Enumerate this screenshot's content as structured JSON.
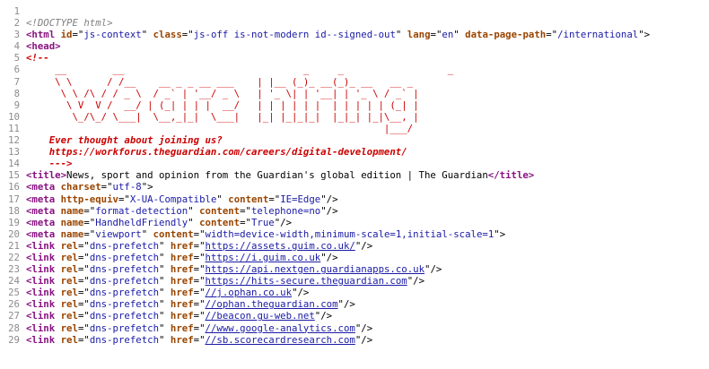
{
  "viewer": {
    "name": "page-source-view"
  },
  "lines": [
    {
      "n": "1",
      "parts": []
    },
    {
      "n": "2",
      "parts": [
        {
          "c": "doct",
          "t": "<!DOCTYPE html>"
        }
      ]
    },
    {
      "n": "3",
      "parts": [
        {
          "c": "tag",
          "t": "<html"
        },
        {
          "c": "punc",
          "t": " "
        },
        {
          "c": "anm",
          "t": "id"
        },
        {
          "c": "punc",
          "t": "=\""
        },
        {
          "c": "av",
          "t": "js-context"
        },
        {
          "c": "punc",
          "t": "\" "
        },
        {
          "c": "anm",
          "t": "class"
        },
        {
          "c": "punc",
          "t": "=\""
        },
        {
          "c": "av",
          "t": "js-off is-not-modern id--signed-out"
        },
        {
          "c": "punc",
          "t": "\" "
        },
        {
          "c": "anm",
          "t": "lang"
        },
        {
          "c": "punc",
          "t": "=\""
        },
        {
          "c": "av",
          "t": "en"
        },
        {
          "c": "punc",
          "t": "\" "
        },
        {
          "c": "anm",
          "t": "data-page-path"
        },
        {
          "c": "punc",
          "t": "=\""
        },
        {
          "c": "av",
          "t": "/international"
        },
        {
          "c": "punc",
          "t": "\">"
        }
      ]
    },
    {
      "n": "4",
      "parts": [
        {
          "c": "tag",
          "t": "<head>"
        }
      ]
    },
    {
      "n": "5",
      "parts": [
        {
          "c": "cmtb",
          "t": "<!--"
        }
      ]
    },
    {
      "n": "6",
      "parts": [
        {
          "c": "cmtart",
          "t": "     __        __                               _     _                  _               "
        }
      ]
    },
    {
      "n": "7",
      "parts": [
        {
          "c": "cmtart",
          "t": "     \\ \\      / /__    __ _ _ __ ___    | |__ (_)_ __(_)_ __   __ _ "
        }
      ]
    },
    {
      "n": "8",
      "parts": [
        {
          "c": "cmtart",
          "t": "      \\ \\ /\\ / / _ \\  / _` | '__/ _ \\   | '_ \\| | '__| | '_ \\ / _` |"
        }
      ]
    },
    {
      "n": "9",
      "parts": [
        {
          "c": "cmtart",
          "t": "       \\ V  V /  __/ | (_| | | |  __/   | | | | | |  | | | | | (_| |"
        }
      ]
    },
    {
      "n": "10",
      "parts": [
        {
          "c": "cmtart",
          "t": "        \\_/\\_/ \\___|  \\__,_|_|  \\___|   |_| |_|_|_|  |_|_| |_|\\__, |"
        }
      ]
    },
    {
      "n": "11",
      "parts": [
        {
          "c": "cmtart",
          "t": "                                                              |___/ "
        }
      ]
    },
    {
      "n": "12",
      "parts": [
        {
          "c": "cmtb",
          "t": "    Ever thought about joining us?"
        }
      ]
    },
    {
      "n": "13",
      "parts": [
        {
          "c": "cmtb",
          "t": "    https://workforus.theguardian.com/careers/digital-development/"
        }
      ]
    },
    {
      "n": "14",
      "parts": [
        {
          "c": "cmtb",
          "t": "    --->"
        }
      ]
    },
    {
      "n": "15",
      "parts": [
        {
          "c": "tag",
          "t": "<title>"
        },
        {
          "c": "txt",
          "t": "News, sport and opinion from the Guardian's global edition | The Guardian"
        },
        {
          "c": "tag",
          "t": "</title>"
        }
      ]
    },
    {
      "n": "16",
      "parts": [
        {
          "c": "tag",
          "t": "<meta"
        },
        {
          "c": "punc",
          "t": " "
        },
        {
          "c": "anm",
          "t": "charset"
        },
        {
          "c": "punc",
          "t": "=\""
        },
        {
          "c": "av",
          "t": "utf-8"
        },
        {
          "c": "punc",
          "t": "\">"
        }
      ]
    },
    {
      "n": "17",
      "parts": [
        {
          "c": "tag",
          "t": "<meta"
        },
        {
          "c": "punc",
          "t": " "
        },
        {
          "c": "anm",
          "t": "http-equiv"
        },
        {
          "c": "punc",
          "t": "=\""
        },
        {
          "c": "av",
          "t": "X-UA-Compatible"
        },
        {
          "c": "punc",
          "t": "\" "
        },
        {
          "c": "anm",
          "t": "content"
        },
        {
          "c": "punc",
          "t": "=\""
        },
        {
          "c": "av",
          "t": "IE=Edge"
        },
        {
          "c": "punc",
          "t": "\"/>"
        }
      ]
    },
    {
      "n": "18",
      "parts": [
        {
          "c": "tag",
          "t": "<meta"
        },
        {
          "c": "punc",
          "t": " "
        },
        {
          "c": "anm",
          "t": "name"
        },
        {
          "c": "punc",
          "t": "=\""
        },
        {
          "c": "av",
          "t": "format-detection"
        },
        {
          "c": "punc",
          "t": "\" "
        },
        {
          "c": "anm",
          "t": "content"
        },
        {
          "c": "punc",
          "t": "=\""
        },
        {
          "c": "av",
          "t": "telephone=no"
        },
        {
          "c": "punc",
          "t": "\"/>"
        }
      ]
    },
    {
      "n": "19",
      "parts": [
        {
          "c": "tag",
          "t": "<meta"
        },
        {
          "c": "punc",
          "t": " "
        },
        {
          "c": "anm",
          "t": "name"
        },
        {
          "c": "punc",
          "t": "=\""
        },
        {
          "c": "av",
          "t": "HandheldFriendly"
        },
        {
          "c": "punc",
          "t": "\" "
        },
        {
          "c": "anm",
          "t": "content"
        },
        {
          "c": "punc",
          "t": "=\""
        },
        {
          "c": "av",
          "t": "True"
        },
        {
          "c": "punc",
          "t": "\"/>"
        }
      ]
    },
    {
      "n": "20",
      "parts": [
        {
          "c": "tag",
          "t": "<meta"
        },
        {
          "c": "punc",
          "t": " "
        },
        {
          "c": "anm",
          "t": "name"
        },
        {
          "c": "punc",
          "t": "=\""
        },
        {
          "c": "av",
          "t": "viewport"
        },
        {
          "c": "punc",
          "t": "\" "
        },
        {
          "c": "anm",
          "t": "content"
        },
        {
          "c": "punc",
          "t": "=\""
        },
        {
          "c": "av",
          "t": "width=device-width,minimum-scale=1,initial-scale=1"
        },
        {
          "c": "punc",
          "t": "\">"
        }
      ]
    },
    {
      "n": "21",
      "parts": [
        {
          "c": "tag",
          "t": "<link"
        },
        {
          "c": "punc",
          "t": " "
        },
        {
          "c": "anm",
          "t": "rel"
        },
        {
          "c": "punc",
          "t": "=\""
        },
        {
          "c": "av",
          "t": "dns-prefetch"
        },
        {
          "c": "punc",
          "t": "\" "
        },
        {
          "c": "anm",
          "t": "href"
        },
        {
          "c": "punc",
          "t": "=\""
        },
        {
          "c": "lnk",
          "t": "https://assets.guim.co.uk/"
        },
        {
          "c": "punc",
          "t": "\"/>"
        }
      ]
    },
    {
      "n": "22",
      "parts": [
        {
          "c": "tag",
          "t": "<link"
        },
        {
          "c": "punc",
          "t": " "
        },
        {
          "c": "anm",
          "t": "rel"
        },
        {
          "c": "punc",
          "t": "=\""
        },
        {
          "c": "av",
          "t": "dns-prefetch"
        },
        {
          "c": "punc",
          "t": "\" "
        },
        {
          "c": "anm",
          "t": "href"
        },
        {
          "c": "punc",
          "t": "=\""
        },
        {
          "c": "lnk",
          "t": "https://i.guim.co.uk"
        },
        {
          "c": "punc",
          "t": "\"/>"
        }
      ]
    },
    {
      "n": "23",
      "parts": [
        {
          "c": "tag",
          "t": "<link"
        },
        {
          "c": "punc",
          "t": " "
        },
        {
          "c": "anm",
          "t": "rel"
        },
        {
          "c": "punc",
          "t": "=\""
        },
        {
          "c": "av",
          "t": "dns-prefetch"
        },
        {
          "c": "punc",
          "t": "\" "
        },
        {
          "c": "anm",
          "t": "href"
        },
        {
          "c": "punc",
          "t": "=\""
        },
        {
          "c": "lnk",
          "t": "https://api.nextgen.guardianapps.co.uk"
        },
        {
          "c": "punc",
          "t": "\"/>"
        }
      ]
    },
    {
      "n": "24",
      "parts": [
        {
          "c": "tag",
          "t": "<link"
        },
        {
          "c": "punc",
          "t": " "
        },
        {
          "c": "anm",
          "t": "rel"
        },
        {
          "c": "punc",
          "t": "=\""
        },
        {
          "c": "av",
          "t": "dns-prefetch"
        },
        {
          "c": "punc",
          "t": "\" "
        },
        {
          "c": "anm",
          "t": "href"
        },
        {
          "c": "punc",
          "t": "=\""
        },
        {
          "c": "lnk",
          "t": "https://hits-secure.theguardian.com"
        },
        {
          "c": "punc",
          "t": "\"/>"
        }
      ]
    },
    {
      "n": "25",
      "parts": [
        {
          "c": "tag",
          "t": "<link"
        },
        {
          "c": "punc",
          "t": " "
        },
        {
          "c": "anm",
          "t": "rel"
        },
        {
          "c": "punc",
          "t": "=\""
        },
        {
          "c": "av",
          "t": "dns-prefetch"
        },
        {
          "c": "punc",
          "t": "\" "
        },
        {
          "c": "anm",
          "t": "href"
        },
        {
          "c": "punc",
          "t": "=\""
        },
        {
          "c": "lnk",
          "t": "//j.ophan.co.uk"
        },
        {
          "c": "punc",
          "t": "\"/>"
        }
      ]
    },
    {
      "n": "26",
      "parts": [
        {
          "c": "tag",
          "t": "<link"
        },
        {
          "c": "punc",
          "t": " "
        },
        {
          "c": "anm",
          "t": "rel"
        },
        {
          "c": "punc",
          "t": "=\""
        },
        {
          "c": "av",
          "t": "dns-prefetch"
        },
        {
          "c": "punc",
          "t": "\" "
        },
        {
          "c": "anm",
          "t": "href"
        },
        {
          "c": "punc",
          "t": "=\""
        },
        {
          "c": "lnk",
          "t": "//ophan.theguardian.com"
        },
        {
          "c": "punc",
          "t": "\"/>"
        }
      ]
    },
    {
      "n": "27",
      "parts": [
        {
          "c": "tag",
          "t": "<link"
        },
        {
          "c": "punc",
          "t": " "
        },
        {
          "c": "anm",
          "t": "rel"
        },
        {
          "c": "punc",
          "t": "=\""
        },
        {
          "c": "av",
          "t": "dns-prefetch"
        },
        {
          "c": "punc",
          "t": "\" "
        },
        {
          "c": "anm",
          "t": "href"
        },
        {
          "c": "punc",
          "t": "=\""
        },
        {
          "c": "lnk",
          "t": "//beacon.gu-web.net"
        },
        {
          "c": "punc",
          "t": "\"/>"
        }
      ]
    },
    {
      "n": "28",
      "parts": [
        {
          "c": "tag",
          "t": "<link"
        },
        {
          "c": "punc",
          "t": " "
        },
        {
          "c": "anm",
          "t": "rel"
        },
        {
          "c": "punc",
          "t": "=\""
        },
        {
          "c": "av",
          "t": "dns-prefetch"
        },
        {
          "c": "punc",
          "t": "\" "
        },
        {
          "c": "anm",
          "t": "href"
        },
        {
          "c": "punc",
          "t": "=\""
        },
        {
          "c": "lnk",
          "t": "//www.google-analytics.com"
        },
        {
          "c": "punc",
          "t": "\"/>"
        }
      ]
    },
    {
      "n": "29",
      "parts": [
        {
          "c": "tag",
          "t": "<link"
        },
        {
          "c": "punc",
          "t": " "
        },
        {
          "c": "anm",
          "t": "rel"
        },
        {
          "c": "punc",
          "t": "=\""
        },
        {
          "c": "av",
          "t": "dns-prefetch"
        },
        {
          "c": "punc",
          "t": "\" "
        },
        {
          "c": "anm",
          "t": "href"
        },
        {
          "c": "punc",
          "t": "=\""
        },
        {
          "c": "lnk",
          "t": "//sb.scorecardresearch.com"
        },
        {
          "c": "punc",
          "t": "\"/>"
        }
      ]
    }
  ]
}
